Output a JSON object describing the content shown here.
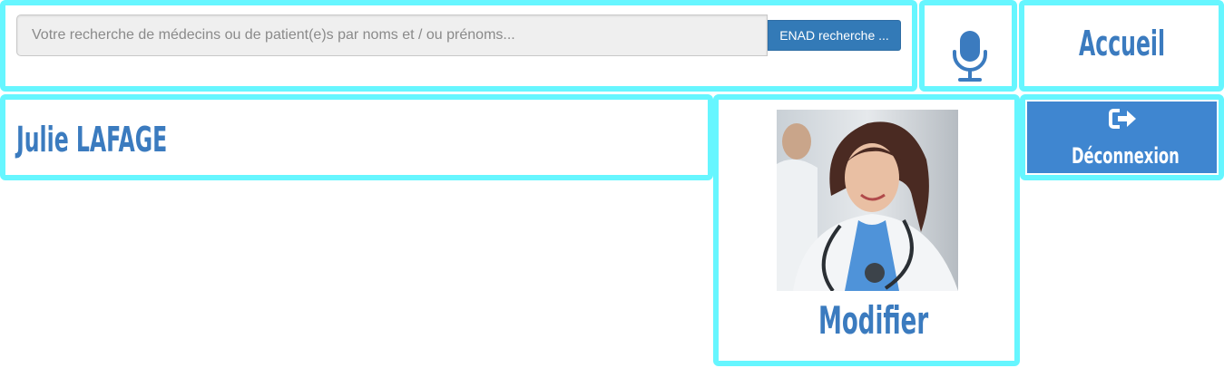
{
  "search": {
    "value": "",
    "placeholder": "Votre recherche de médecins ou de patient(e)s par noms et / ou prénoms...",
    "button_label": "ENAD recherche ..."
  },
  "voice": {
    "icon": "microphone-icon"
  },
  "nav": {
    "home_label": "Accueil",
    "logout_label": "Déconnexion",
    "logout_icon": "sign-out-icon"
  },
  "user": {
    "name": "Julie LAFAGE",
    "edit_label": "Modifier"
  },
  "colors": {
    "panel_border": "#66f6ff",
    "brand_text": "#3b7bbf",
    "search_button": "#337ab7",
    "logout_button": "#3f86d0"
  }
}
